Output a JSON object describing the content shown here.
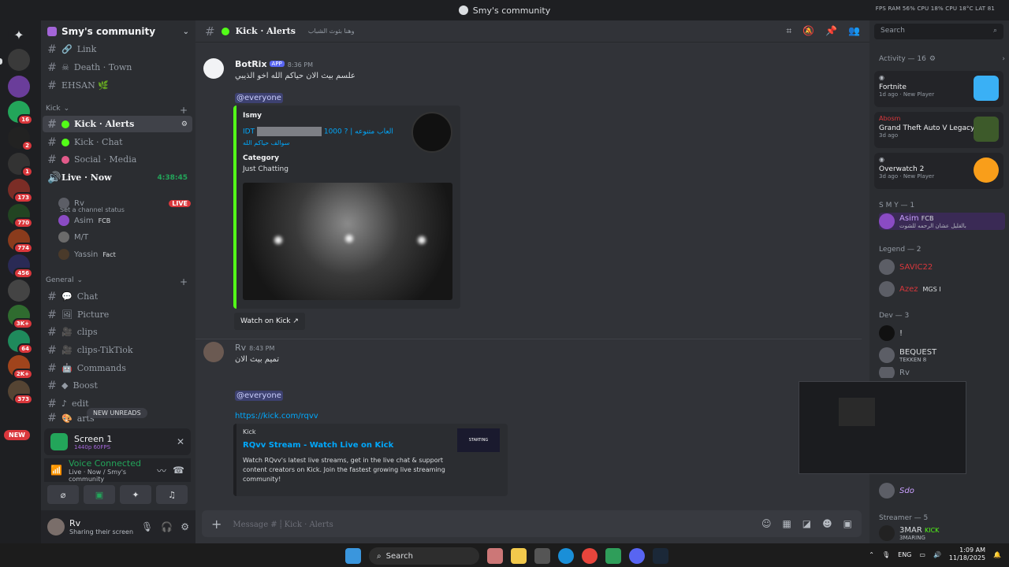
{
  "window": {
    "title": "Smy's community",
    "tray_stats": "FPS  RAM 56%  CPU 18%  CPU 18°C  LAT 81"
  },
  "guilds": [
    {
      "badge": ""
    },
    {
      "badge": "16"
    },
    {
      "badge": "2"
    },
    {
      "badge": "1"
    },
    {
      "badge": "173"
    },
    {
      "badge": "770"
    },
    {
      "badge": "774"
    },
    {
      "badge": "456"
    },
    {
      "badge": ""
    },
    {
      "badge": "3K+"
    },
    {
      "badge": "64"
    },
    {
      "badge": "2K+"
    },
    {
      "badge": "373"
    }
  ],
  "new_label": "NEW",
  "server": {
    "name": "Smy's community"
  },
  "channels": {
    "top": [
      "Link",
      "Death · Town",
      "EHSAN 🌿"
    ],
    "cat_kick": "Kick",
    "kick": [
      "Kick · Alerts",
      "Kick · Chat",
      "Social · Media"
    ],
    "voice": {
      "name": "Live · Now",
      "time": "4:38:45",
      "status": "Set a channel status"
    },
    "voice_users": [
      {
        "name": "Rv",
        "badge": "LIVE"
      },
      {
        "name": "Asim",
        "tag": "FCB"
      },
      {
        "name": "M/T",
        "tag": ""
      },
      {
        "name": "Yassin",
        "tag": "Fact"
      }
    ],
    "cat_general": "General",
    "general": [
      "Chat",
      "Picture",
      "clips",
      "clips-TikTiok",
      "Commands",
      "Boost",
      "edit",
      "arts"
    ],
    "new_unreads": "NEW UNREADS"
  },
  "screen_share": {
    "title": "Screen 1",
    "quality": "1440p 60FPS"
  },
  "voice_status": {
    "title": "Voice Connected",
    "sub": "Live · Now / Smy's community"
  },
  "user": {
    "name": "Rv",
    "status": "Sharing their screen"
  },
  "header": {
    "channel": "Kick · Alerts",
    "topic": "وهنا بثوث الشباب"
  },
  "messages": {
    "m1": {
      "author": "BotRix",
      "app": "APP",
      "time": "8:36 PM",
      "text": "علسم بيث الان حياكم الله اخو الذيبي",
      "mention": "@everyone",
      "embed": {
        "author": "Ismy",
        "title_prefix": "IDT",
        "title_suffix": "1000 ? | العاب متنوعه",
        "title_line2": "سوالف حياكم الله",
        "field_label": "Category",
        "field_value": "Just Chatting"
      },
      "watch": "Watch on Kick"
    },
    "m2": {
      "author": "Rv",
      "time": "8:43 PM",
      "text": "تميم بيث الان",
      "mention": "@everyone",
      "link": "https://kick.com/rqvv",
      "embed": {
        "provider": "Kick",
        "title": "RQvv Stream - Watch Live on Kick",
        "desc": "Watch RQvv's latest live streams, get in the live chat & support content creators on Kick. Join the fastest growing live streaming community!",
        "thumb": "STARTING"
      }
    }
  },
  "composer": {
    "placeholder": "Message #  ⸽ Kick · Alerts"
  },
  "members": {
    "search": "Search",
    "activity_header": "Activity — 16",
    "activities": [
      {
        "game": "Fortnite",
        "when": "1d ago",
        "tag": "New Player",
        "user": ""
      },
      {
        "game": "Grand Theft Auto V Legacy",
        "when": "3d ago",
        "tag": "",
        "user": "Abosm"
      },
      {
        "game": "Overwatch 2",
        "when": "3d ago",
        "tag": "New Player",
        "user": ""
      }
    ],
    "smy_header": "S M Y — 1",
    "smy": [
      {
        "name": "Asim",
        "tag": "FCB",
        "sub": "بالقليل عشان الرحمه للشوت"
      }
    ],
    "legend_header": "Legend — 2",
    "legend": [
      {
        "name": "SAVIC22",
        "tag": ""
      },
      {
        "name": "Azez",
        "tag": "MGS I"
      }
    ],
    "dev_header": "Dev — 3",
    "dev": [
      {
        "name": "!",
        "sub": ""
      },
      {
        "name": "BEQUEST",
        "sub": "TEKKEN 8"
      },
      {
        "name": "Rv",
        "sub": ""
      }
    ],
    "misc": [
      {
        "name": "Sdo"
      }
    ],
    "streamer_header": "Streamer — 5",
    "streamer": [
      {
        "name": "3MAR",
        "tag": "KICK",
        "sub": "3MARING"
      }
    ]
  },
  "taskbar": {
    "search": "Search",
    "lang": "ENG",
    "time": "1:09 AM",
    "date": "11/18/2025"
  },
  "colors": {
    "accent": "#5865f2",
    "kick": "#53fc18",
    "online": "#23a55a",
    "danger": "#da373c"
  }
}
